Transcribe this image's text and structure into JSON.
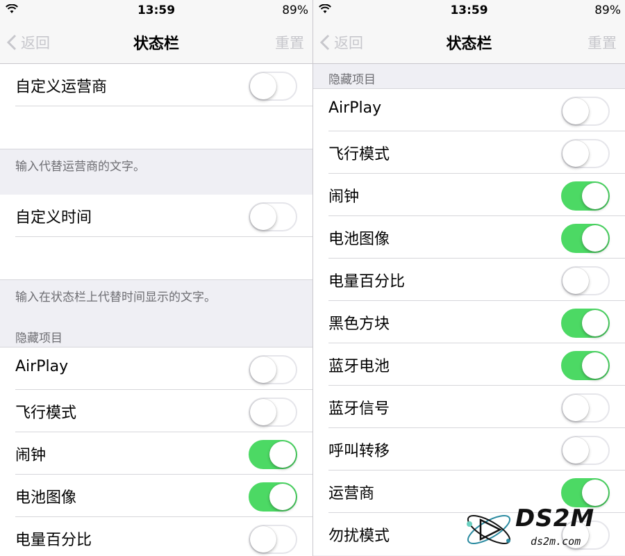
{
  "status_bar": {
    "time": "13:59",
    "battery": "89%"
  },
  "nav": {
    "back_label": "返回",
    "title": "状态栏",
    "reset_label": "重置"
  },
  "left": {
    "carrier_label": "自定义运营商",
    "carrier_footer": "输入代替运营商的文字。",
    "time_label": "自定义时间",
    "time_footer": "输入在状态栏上代替时间显示的文字。",
    "hidden_header": "隐藏项目",
    "items": [
      {
        "label": "AirPlay",
        "on": false
      },
      {
        "label": "飞行模式",
        "on": false
      },
      {
        "label": "闹钟",
        "on": true
      },
      {
        "label": "电池图像",
        "on": true
      },
      {
        "label": "电量百分比",
        "on": false
      }
    ]
  },
  "right": {
    "hidden_header": "隐藏项目",
    "items": [
      {
        "label": "AirPlay",
        "on": false
      },
      {
        "label": "飞行模式",
        "on": false
      },
      {
        "label": "闹钟",
        "on": true
      },
      {
        "label": "电池图像",
        "on": true
      },
      {
        "label": "电量百分比",
        "on": false
      },
      {
        "label": "黑色方块",
        "on": true
      },
      {
        "label": "蓝牙电池",
        "on": true
      },
      {
        "label": "蓝牙信号",
        "on": false
      },
      {
        "label": "呼叫转移",
        "on": false
      },
      {
        "label": "运营商",
        "on": true
      },
      {
        "label": "勿扰模式",
        "on": false
      }
    ]
  },
  "watermark": {
    "brand": "DS2M",
    "site": "ds2m.com"
  },
  "colors": {
    "toggle_on": "#4cd964",
    "toggle_off_border": "#e5e5ea",
    "inactive_nav": "#c7c7cc",
    "background": "#efeff4"
  }
}
